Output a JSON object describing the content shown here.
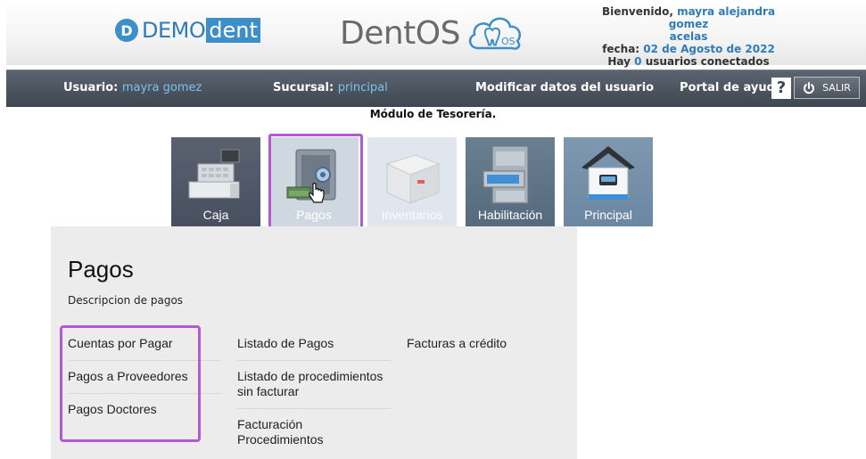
{
  "header": {
    "brand_demo_mark": "D",
    "brand_demo_text": "DEMO",
    "brand_demo_suffix": "dent",
    "brand_dentos_text": "DentOS",
    "brand_dentos_badge": "OS",
    "welcome_label": "Bienvenido,",
    "welcome_user_line1": "mayra alejandra gomez",
    "welcome_user_line2": "acelas",
    "date_label": "fecha:",
    "date_value": "02 de Agosto de 2022",
    "users_prefix": "Hay",
    "users_count": "0",
    "users_suffix": "usuarios conectados"
  },
  "navbar": {
    "user_label": "Usuario:",
    "user_value": "mayra gomez",
    "branch_label": "Sucursal:",
    "branch_value": "principal",
    "modify_label": "Modificar datos del usuario",
    "help_label": "Portal de ayuda",
    "help_icon": "?",
    "exit_label": "SALIR"
  },
  "module_title": "Módulo de Tesorería.",
  "tiles": [
    {
      "label": "Caja",
      "icon": "cash-register-icon"
    },
    {
      "label": "Pagos",
      "icon": "safe-icon",
      "selected": true
    },
    {
      "label": "Inventarios",
      "icon": "box-icon"
    },
    {
      "label": "Habilitación",
      "icon": "file-cabinet-icon"
    },
    {
      "label": "Principal",
      "icon": "home-icon"
    }
  ],
  "panel": {
    "title": "Pagos",
    "description": "Descripcion de pagos",
    "col1": [
      "Cuentas por Pagar",
      "Pagos a Proveedores",
      "Pagos Doctores"
    ],
    "col2": [
      "Listado de Pagos",
      "Listado de procedimientos sin facturar",
      "Facturación Procedimientos"
    ],
    "col3": [
      "Facturas a crédito"
    ]
  },
  "colors": {
    "highlight": "#b458d4",
    "accent_blue": "#2f7cb8",
    "navbar": "#4a525c",
    "panel_bg": "#ececec"
  }
}
